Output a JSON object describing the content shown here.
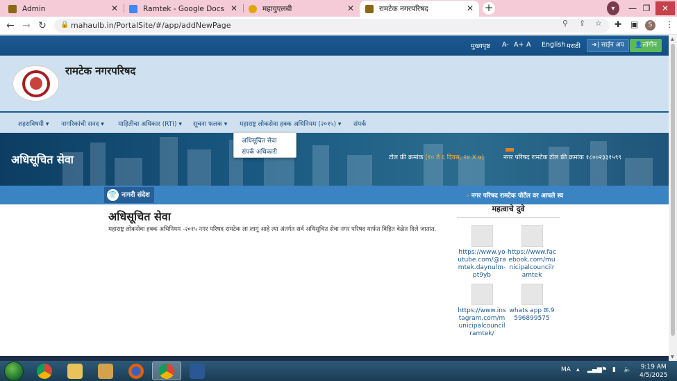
{
  "browser": {
    "tabs": [
      {
        "title": "Admin",
        "favicon": "school-icon",
        "favicon_color": "#8b6914"
      },
      {
        "title": "Ramtek - Google Docs",
        "favicon": "docs-icon",
        "favicon_color": "#4285f4"
      },
      {
        "title": "महायुएलबी",
        "favicon": "emblem-icon",
        "favicon_color": "#e0a800"
      },
      {
        "title": "रामटेक नगरपरिषद",
        "favicon": "school-icon",
        "favicon_color": "#8b6914",
        "active": true
      }
    ],
    "url": "mahaulb.in/PortalSite/#/app/addNewPage",
    "profile_initial": "S"
  },
  "site": {
    "topstrip": {
      "home": "मुख्यपृष्ठ",
      "font_small": "A-",
      "font_large": "A+",
      "font_normal": "A",
      "lang_en": "English",
      "lang_mr": "मराठी",
      "signup": "➔] साईन अप",
      "login": "👤लॉगीन"
    },
    "title": "रामटेक नगरपरिषद",
    "nav": [
      "शहराविषयी ▾",
      "नागरिकांची सनद ▾",
      "माहितीचा अधिकार (RTI) ▾",
      "सूचना फलक ▾",
      "महाराष्ट्र लोकसेवा हक्क अधिनियम (२०१५) ▾",
      "संपर्क"
    ],
    "dropdown": [
      "अधिसूचित सेवा",
      "संपर्क अधिकारी"
    ],
    "banner": {
      "title": "अधिसूचित सेवा",
      "tollfree_label": "टोल फ्री क्रमांक",
      "tollfree_hours": "(१० ते ६ दिवस, २४ X ७)",
      "ticker": "नगर परिषद रामटेक टोल फ्री क्रमांक १८००२३३१५९९"
    },
    "notice": {
      "badge": "नागरी संदेश",
      "text": "नगर परिषद रामटेक पोर्टेल वर आपले स्व"
    },
    "content": {
      "title": "अधिसूचित सेवा",
      "body": "महाराष्ट्र लोकसेवा हक्क अधिनियम -२०१५ नगर परिषद रामटेक ला लागू आहे त्या अंतर्गत सर्व अधिसूचित सेवा नगर परिषद मार्फत विहित वेळेत दिले जातात."
    },
    "links": {
      "title": "महत्वाचे दुवे",
      "items": [
        "https://www.youtube.com/@ramtek.daynulm-pt9yb",
        "https://www.facebook.com/municipalcouncilramtek",
        "https://www.instagram.com/municipalcouncilramtek/",
        "whats app क्र.9596899575"
      ]
    }
  },
  "taskbar": {
    "tray_lang": "MA",
    "time": "9:19 AM",
    "date": "4/5/2025"
  }
}
